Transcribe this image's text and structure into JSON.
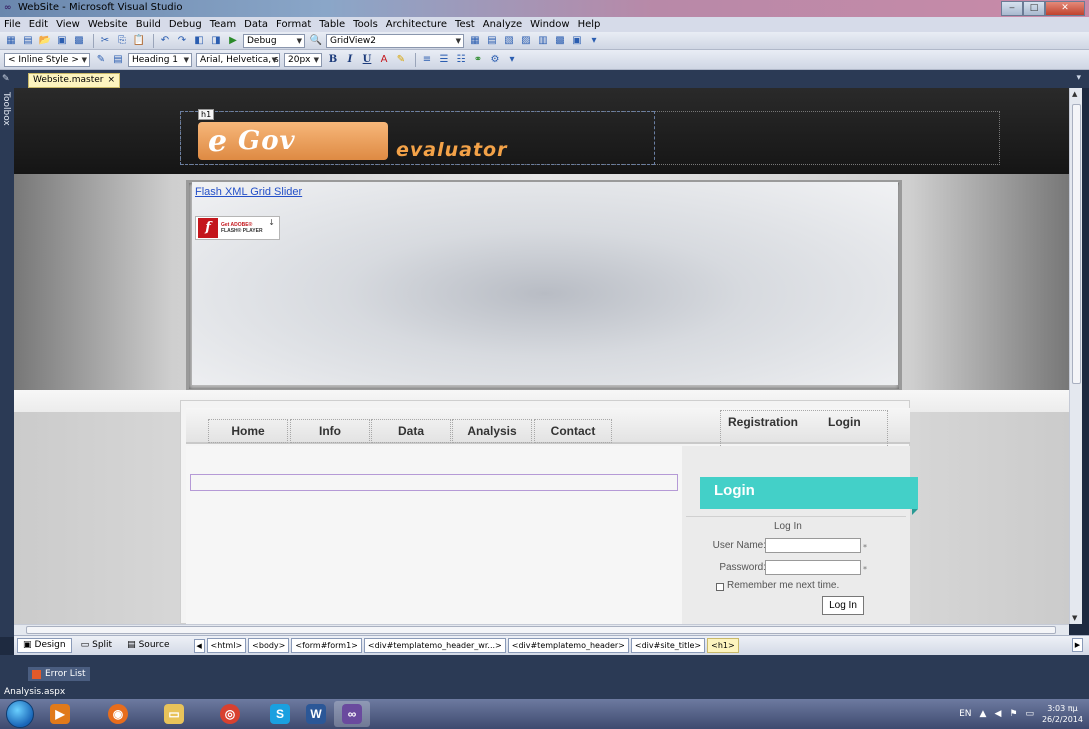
{
  "window": {
    "title": "WebSite - Microsoft Visual Studio",
    "controls": {
      "minimize": "‒",
      "maximize": "□",
      "close": "✕"
    }
  },
  "menu": [
    "File",
    "Edit",
    "View",
    "Website",
    "Build",
    "Debug",
    "Team",
    "Data",
    "Format",
    "Table",
    "Tools",
    "Architecture",
    "Test",
    "Analyze",
    "Window",
    "Help"
  ],
  "toolbar1": {
    "config": "Debug",
    "target": "GridView2"
  },
  "toolbar2": {
    "style": "< Inline Style >",
    "block_format": "Heading 1",
    "font": "Arial, Helvetica, s",
    "size": "20px",
    "bold": "B",
    "italic": "I",
    "underline": "U"
  },
  "left_rail": {
    "toolbox_label": "Toolbox"
  },
  "document_tab": {
    "label": "Website.master",
    "close": "×"
  },
  "site": {
    "h1_tag": "h1",
    "logo_e": "e",
    "logo_gov": "Gov",
    "logo_sub": "evaluator",
    "flash_link": "Flash XML Grid Slider",
    "flash_badge": {
      "line1": "Get ADOBE®",
      "line2": "FLASH® PLAYER"
    },
    "nav": [
      "Home",
      "Info",
      "Data",
      "Analysis",
      "Contact"
    ],
    "nav_right": [
      "Registration",
      "Login"
    ],
    "login_banner": "Login",
    "login_form": {
      "title": "Log In",
      "user_label": "User Name:",
      "password_label": "Password:",
      "remember": "Remember me next time.",
      "button": "Log In",
      "required_mark": "*"
    }
  },
  "designbar": {
    "views": [
      "Design",
      "Split",
      "Source"
    ],
    "breadcrumbs": [
      "<html>",
      "<body>",
      "<form#form1>",
      "<div#templatemo_header_wr...>",
      "<div#templatemo_header>",
      "<div#site_title>",
      "<h1>"
    ]
  },
  "error_list": {
    "label": "Error List"
  },
  "status": {
    "file": "Analysis.aspx"
  },
  "taskbar": {
    "apps": [
      "media-player",
      "firefox",
      "explorer",
      "chrome",
      "skype",
      "word",
      "visual-studio"
    ],
    "tray": {
      "lang": "EN",
      "time": "3:03 πμ",
      "date": "26/2/2014"
    }
  }
}
